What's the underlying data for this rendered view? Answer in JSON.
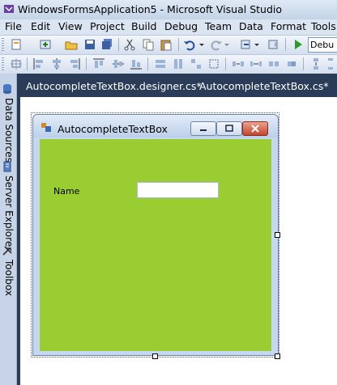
{
  "window": {
    "title": "WindowsFormsApplication5 - Microsoft Visual Studio"
  },
  "menu": [
    "File",
    "Edit",
    "View",
    "Project",
    "Build",
    "Debug",
    "Team",
    "Data",
    "Format",
    "Tools"
  ],
  "toolbar": {
    "configuration": "Debu"
  },
  "doc_tabs": [
    "AutocompleteTextBox.designer.cs*",
    "AutocompleteTextBox.cs*"
  ],
  "side_panel": [
    "Data Sources",
    "Server Explorer",
    "Toolbox"
  ],
  "form": {
    "title": "AutocompleteTextBox",
    "client_color": "#9acd32",
    "name_label": "Name",
    "name_value": ""
  }
}
